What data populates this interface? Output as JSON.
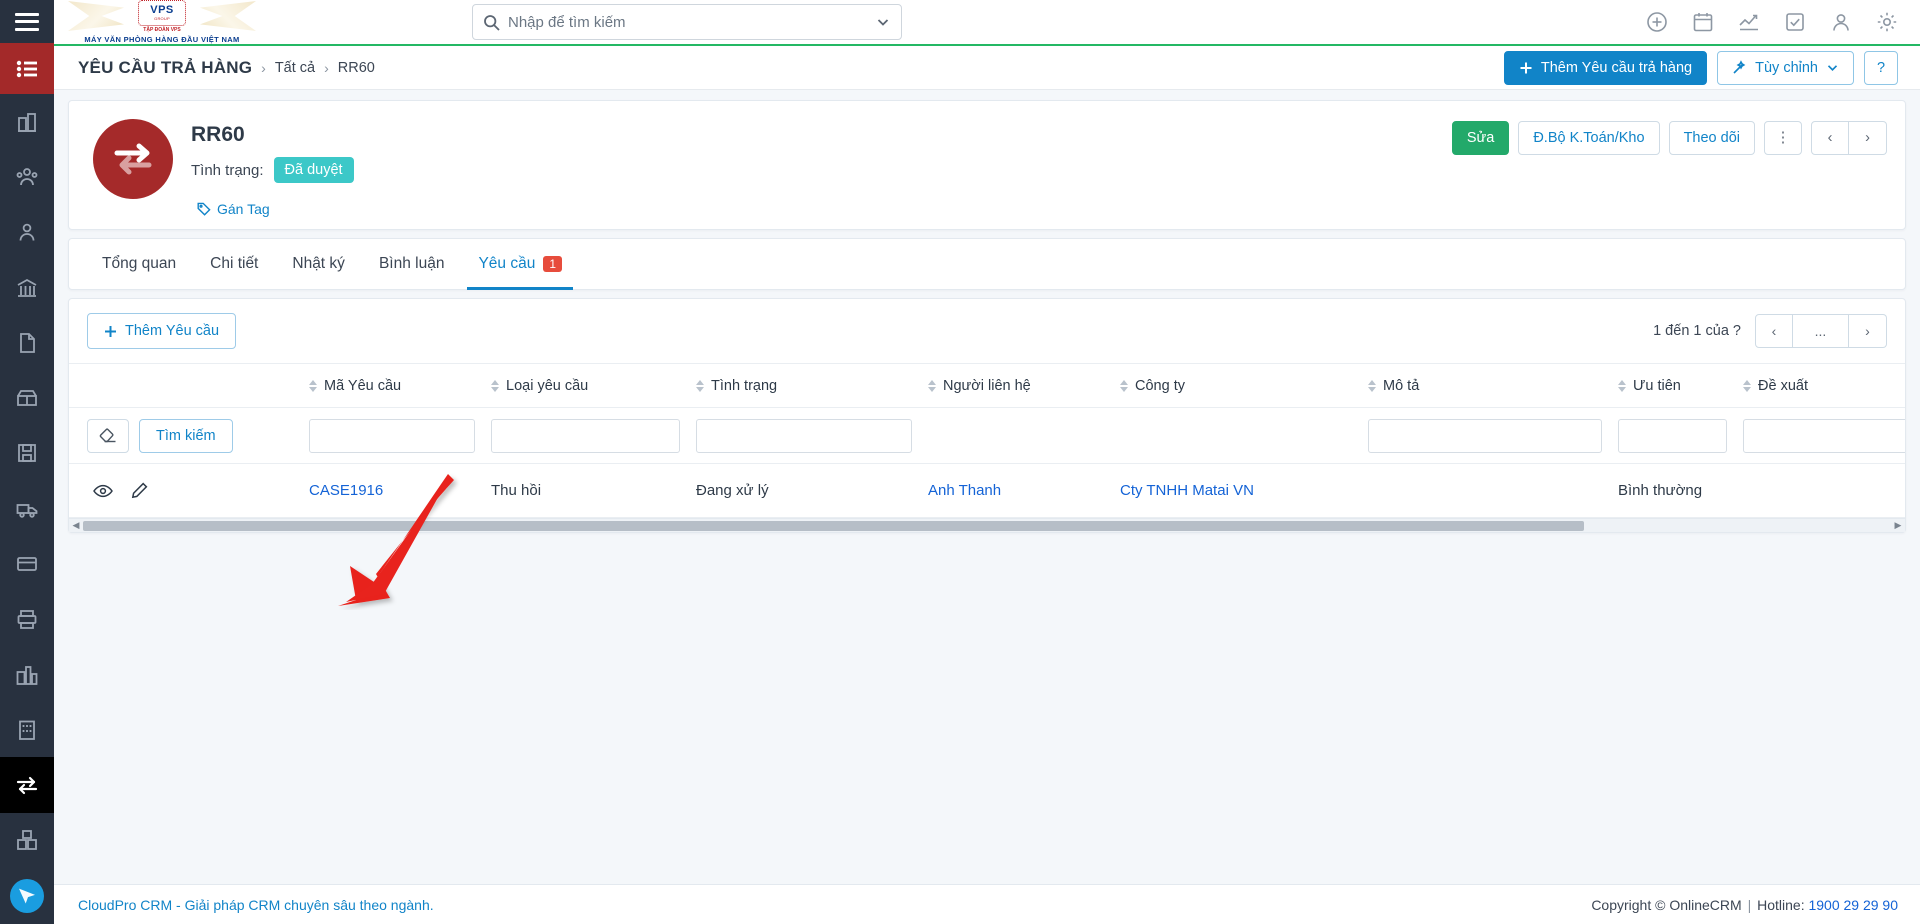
{
  "brand": {
    "seal_text": "VPS",
    "seal_group": "GROUP",
    "seal_sub": "TẬP ĐOÀN VPS",
    "tagline": "MÁY VĂN PHÒNG HÀNG ĐẦU VIỆT NAM"
  },
  "search": {
    "placeholder": "Nhập để tìm kiếm",
    "value": ""
  },
  "topbar": {
    "icons": [
      "plus-circle-icon",
      "calendar-icon",
      "chart-icon",
      "task-check-icon",
      "user-icon",
      "gear-icon"
    ]
  },
  "breadcrumb": {
    "title": "YÊU CẦU TRẢ HÀNG",
    "items": [
      "Tất cả",
      "RR60"
    ],
    "separator": "›",
    "add_button": "Thêm Yêu cầu trả hàng",
    "customize_button": "Tùy chỉnh",
    "help_button": "?"
  },
  "record": {
    "title": "RR60",
    "status_label": "Tình trạng:",
    "status_value": "Đã duyệt",
    "tag_link": "Gán Tag",
    "avatar_icon": "exchange-arrows-icon",
    "actions": {
      "edit": "Sửa",
      "sync": "Đ.Bộ K.Toán/Kho",
      "follow": "Theo dõi",
      "kebab": "⋮",
      "prev": "‹",
      "next": "›"
    }
  },
  "tabs": [
    {
      "label": "Tổng quan",
      "active": false,
      "badge": ""
    },
    {
      "label": "Chi tiết",
      "active": false,
      "badge": ""
    },
    {
      "label": "Nhật ký",
      "active": false,
      "badge": ""
    },
    {
      "label": "Bình luận",
      "active": false,
      "badge": ""
    },
    {
      "label": "Yêu cầu",
      "active": true,
      "badge": "1"
    }
  ],
  "list": {
    "add_button": "Thêm Yêu cầu",
    "pager_text": "1 đến 1 của",
    "pager_total": "?",
    "pager_prev": "‹",
    "pager_more": "...",
    "pager_next": "›",
    "search_button": "Tìm kiếm",
    "eraser_icon": "eraser-icon",
    "columns": [
      {
        "label": "Mã Yêu cầu",
        "sortable": true
      },
      {
        "label": "Loại yêu cầu",
        "sortable": true
      },
      {
        "label": "Tình trạng",
        "sortable": true
      },
      {
        "label": "Người liên hệ",
        "sortable": true
      },
      {
        "label": "Công ty",
        "sortable": true
      },
      {
        "label": "Mô tả",
        "sortable": true
      },
      {
        "label": "Ưu tiên",
        "sortable": true
      },
      {
        "label": "Đề xuất",
        "sortable": true
      }
    ],
    "filters": [
      "",
      "",
      "",
      "",
      "",
      "",
      "",
      ""
    ],
    "rows": [
      {
        "view_icon": "eye-icon",
        "edit_icon": "pencil-icon",
        "code": "CASE1916",
        "type": "Thu hồi",
        "status": "Đang xử lý",
        "contact": "Anh Thanh",
        "company": "Cty TNHH Matai VN",
        "description": "",
        "priority": "Bình thường",
        "proposal": ""
      }
    ]
  },
  "footer": {
    "left": "CloudPro CRM - Giải pháp CRM chuyên sâu theo ngành.",
    "copyright": "Copyright © OnlineCRM",
    "separator": "|",
    "hotline_label": "Hotline:",
    "hotline": "1900 29 29 90"
  },
  "colors": {
    "accent_blue": "#1184c8",
    "green": "#23a96a",
    "teal_badge": "#3cc8c8",
    "avatar_red": "#a52a2a",
    "sidebar": "#28313f",
    "sidebar_active_menu": "#a32929",
    "link": "#1463d6",
    "annotation_red": "#e8231d"
  }
}
